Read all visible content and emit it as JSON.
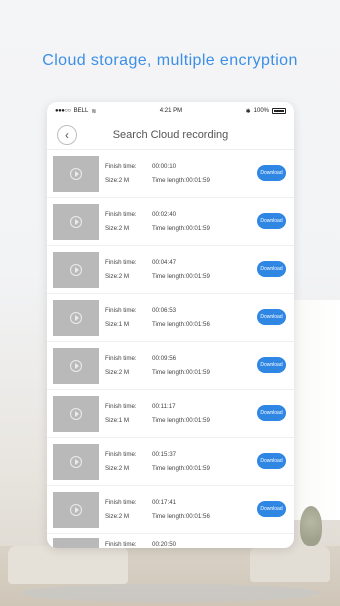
{
  "headline": "Cloud storage, multiple encryption",
  "status_bar": {
    "carrier": "BELL",
    "time": "4:21 PM",
    "battery_text": "100%"
  },
  "nav": {
    "title": "Search Cloud recording",
    "back_icon": "chevron-left-icon"
  },
  "labels": {
    "finish_time": "Finish time:",
    "time_length": "Time length:",
    "download": "Download"
  },
  "recordings": [
    {
      "finish": "00:00:10",
      "size": "Size:2 M",
      "length": "00:01:59"
    },
    {
      "finish": "00:02:40",
      "size": "Size:2 M",
      "length": "00:01:59"
    },
    {
      "finish": "00:04:47",
      "size": "Size:2 M",
      "length": "00:01:59"
    },
    {
      "finish": "00:06:53",
      "size": "Size:1 M",
      "length": "00:01:56"
    },
    {
      "finish": "00:09:56",
      "size": "Size:2 M",
      "length": "00:01:59"
    },
    {
      "finish": "00:11:17",
      "size": "Size:1 M",
      "length": "00:01:59"
    },
    {
      "finish": "00:15:37",
      "size": "Size:2 M",
      "length": "00:01:59"
    },
    {
      "finish": "00:17:41",
      "size": "Size:2 M",
      "length": "00:01:56"
    },
    {
      "finish": "00:20:50",
      "size": "",
      "length": ""
    }
  ],
  "colors": {
    "accent": "#2f86e3",
    "headline": "#3b8fe6",
    "thumb": "#b9b9b9"
  }
}
